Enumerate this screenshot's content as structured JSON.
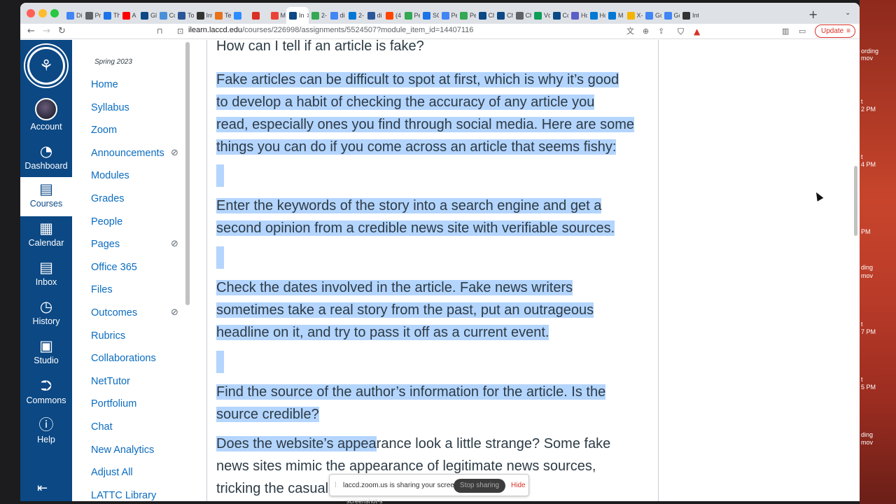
{
  "desktop": {
    "items": [
      "ording",
      "mov",
      "t",
      "2 PM",
      "t",
      "4 PM",
      "PM",
      "ding",
      "mov",
      "t",
      "7 PM",
      "t",
      "5 PM",
      "ding",
      "mov"
    ]
  },
  "browser": {
    "tabs": [
      {
        "title": "Di",
        "color": "#4285f4"
      },
      {
        "title": "Pr",
        "color": "#5f6368"
      },
      {
        "title": "Th",
        "color": "#1a73e8"
      },
      {
        "title": "A",
        "color": "#ff0000"
      },
      {
        "title": "Gl",
        "color": "#0b4884"
      },
      {
        "title": "Cc",
        "color": "#4a90d9"
      },
      {
        "title": "To",
        "color": "#2b5797"
      },
      {
        "title": "Int",
        "color": "#333333"
      },
      {
        "title": "Te",
        "color": "#e8711a"
      },
      {
        "title": "",
        "color": "#2d8cff"
      },
      {
        "title": "",
        "color": "#d93025"
      },
      {
        "title": "M",
        "color": "#ea4335"
      },
      {
        "title": "In",
        "color": "#0b4884"
      },
      {
        "title": "2-",
        "color": "#34a853"
      },
      {
        "title": "di",
        "color": "#4285f4"
      },
      {
        "title": "2-",
        "color": "#0078d4"
      },
      {
        "title": "di",
        "color": "#2b579a"
      },
      {
        "title": "(4",
        "color": "#ff4500"
      },
      {
        "title": "Pe",
        "color": "#34a853"
      },
      {
        "title": "SC",
        "color": "#1a73e8"
      },
      {
        "title": "Pe",
        "color": "#4285f4"
      },
      {
        "title": "Pe",
        "color": "#34a853"
      },
      {
        "title": "Ch",
        "color": "#0b4884"
      },
      {
        "title": "Ch",
        "color": "#0b4884"
      },
      {
        "title": "Ch",
        "color": "#5f6368"
      },
      {
        "title": "Vc",
        "color": "#0f9d58"
      },
      {
        "title": "Cc",
        "color": "#0b4884"
      },
      {
        "title": "Hc",
        "color": "#5b5fc7"
      },
      {
        "title": "Hc",
        "color": "#0078d4"
      },
      {
        "title": "M",
        "color": "#0078d4"
      },
      {
        "title": "X-",
        "color": "#f4b400"
      },
      {
        "title": "Gc",
        "color": "#4285f4"
      },
      {
        "title": "Gc",
        "color": "#4285f4"
      },
      {
        "title": "Int",
        "color": "#333333"
      }
    ],
    "active_tab_title": "In",
    "new_tab": "+",
    "url_domain": "ilearn.laccd.edu",
    "url_path": "/courses/226998/assignments/5524507?module_item_id=14407116",
    "update_label": "Update"
  },
  "global_nav": {
    "logo_letter": "⚘",
    "items": [
      {
        "label": "Account"
      },
      {
        "label": "Dashboard"
      },
      {
        "label": "Courses"
      },
      {
        "label": "Calendar"
      },
      {
        "label": "Inbox"
      },
      {
        "label": "History"
      },
      {
        "label": "Studio"
      },
      {
        "label": "Commons"
      },
      {
        "label": "Help"
      }
    ]
  },
  "course_nav": {
    "term": "Spring 2023",
    "items": [
      {
        "label": "Home"
      },
      {
        "label": "Syllabus"
      },
      {
        "label": "Zoom"
      },
      {
        "label": "Announcements"
      },
      {
        "label": "Modules"
      },
      {
        "label": "Grades"
      },
      {
        "label": "People"
      },
      {
        "label": "Pages"
      },
      {
        "label": "Office 365"
      },
      {
        "label": "Files"
      },
      {
        "label": "Outcomes"
      },
      {
        "label": "Rubrics"
      },
      {
        "label": "Collaborations"
      },
      {
        "label": "NetTutor"
      },
      {
        "label": "Portfolium"
      },
      {
        "label": "Chat"
      },
      {
        "label": "New Analytics"
      },
      {
        "label": "Adjust All"
      },
      {
        "label": "LATTC Library"
      }
    ]
  },
  "content": {
    "heading": "How can I tell if an article is fake?",
    "p1": [
      "Fake articles can be difficult to spot at first, which is why it’s good",
      "to develop a habit of checking the accuracy of any article you",
      "read, especially ones you find through social media. Here are some",
      "things you can do if you come across an article that seems fishy:"
    ],
    "p2": [
      "Enter the keywords of the story into a search engine and get a",
      "second opinion from a credible news site with verifiable sources."
    ],
    "p3": [
      "Check the dates involved in the article. Fake news writers",
      "sometimes take a real story from the past, put an outrageous",
      "headline on it, and try to pass it off as a current event."
    ],
    "p4": [
      "Find the source of the author’s information for the article. Is the",
      "source credible?"
    ],
    "p5_hl": "Does the website’s appea",
    "p5_rest": "rance look a little strange? Some fake",
    "p5": [
      "news sites mimic the appearance of legitimate news sources,",
      "tricking the casual re"
    ]
  },
  "zoom": {
    "message": "laccd.zoom.us is sharing your screen.",
    "stop": "Stop sharing",
    "hide": "Hide",
    "below": "screenshot-s"
  }
}
